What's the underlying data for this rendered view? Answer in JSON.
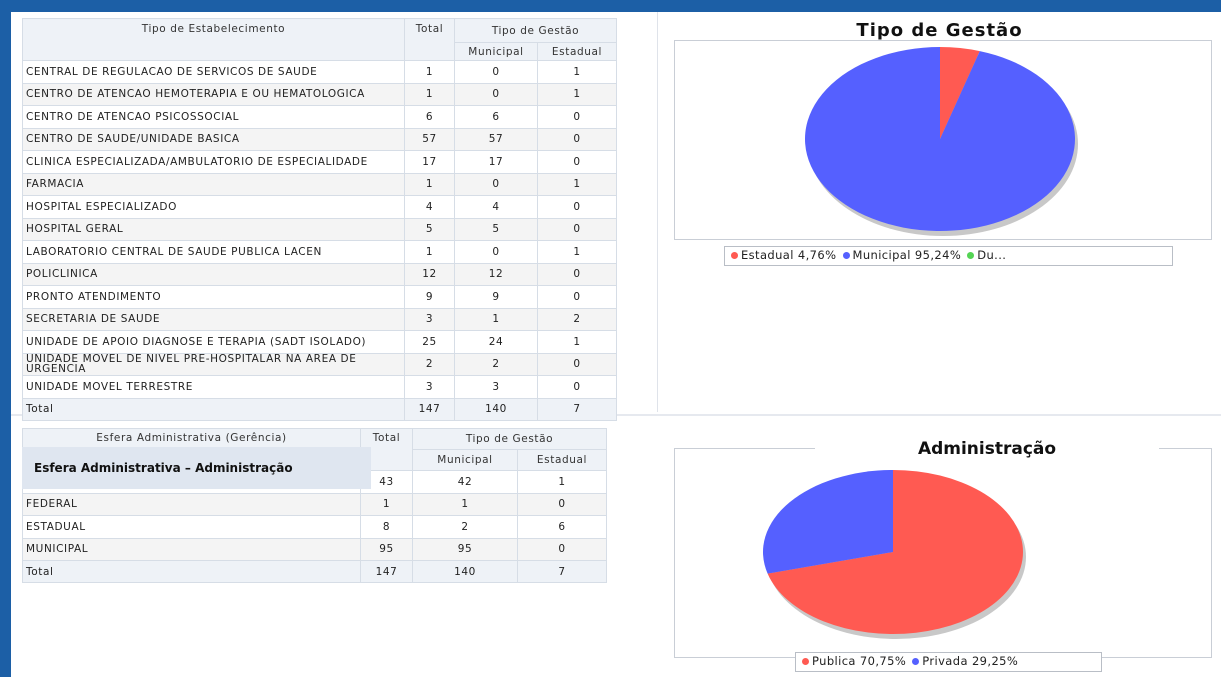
{
  "table_tipo": {
    "header_name": "Tipo de Estabelecimento",
    "header_total": "Total",
    "header_group": "Tipo de Gestão",
    "header_municipal": "Municipal",
    "header_estadual": "Estadual",
    "rows": [
      {
        "name": "CENTRAL DE REGULACAO DE SERVICOS DE SAUDE",
        "total": "1",
        "municipal": "0",
        "estadual": "1"
      },
      {
        "name": "CENTRO DE ATENCAO HEMOTERAPIA E OU HEMATOLOGICA",
        "total": "1",
        "municipal": "0",
        "estadual": "1"
      },
      {
        "name": "CENTRO DE ATENCAO PSICOSSOCIAL",
        "total": "6",
        "municipal": "6",
        "estadual": "0"
      },
      {
        "name": "CENTRO DE SAUDE/UNIDADE BASICA",
        "total": "57",
        "municipal": "57",
        "estadual": "0"
      },
      {
        "name": "CLINICA ESPECIALIZADA/AMBULATORIO DE ESPECIALIDADE",
        "total": "17",
        "municipal": "17",
        "estadual": "0"
      },
      {
        "name": "FARMACIA",
        "total": "1",
        "municipal": "0",
        "estadual": "1"
      },
      {
        "name": "HOSPITAL ESPECIALIZADO",
        "total": "4",
        "municipal": "4",
        "estadual": "0"
      },
      {
        "name": "HOSPITAL GERAL",
        "total": "5",
        "municipal": "5",
        "estadual": "0"
      },
      {
        "name": "LABORATORIO CENTRAL DE SAUDE PUBLICA LACEN",
        "total": "1",
        "municipal": "0",
        "estadual": "1"
      },
      {
        "name": "POLICLINICA",
        "total": "12",
        "municipal": "12",
        "estadual": "0"
      },
      {
        "name": "PRONTO ATENDIMENTO",
        "total": "9",
        "municipal": "9",
        "estadual": "0"
      },
      {
        "name": "SECRETARIA DE SAUDE",
        "total": "3",
        "municipal": "1",
        "estadual": "2"
      },
      {
        "name": "UNIDADE DE APOIO DIAGNOSE E TERAPIA (SADT ISOLADO)",
        "total": "25",
        "municipal": "24",
        "estadual": "1"
      },
      {
        "name": "UNIDADE MOVEL DE NIVEL PRE-HOSPITALAR NA AREA DE URGENCIA",
        "total": "2",
        "municipal": "2",
        "estadual": "0"
      },
      {
        "name": "UNIDADE MOVEL TERRESTRE",
        "total": "3",
        "municipal": "3",
        "estadual": "0"
      }
    ],
    "total_row": {
      "name": "Total",
      "total": "147",
      "municipal": "140",
      "estadual": "7"
    }
  },
  "table_esfera": {
    "header_name": "Esfera Administrativa (Gerência)",
    "header_total": "Total",
    "header_group": "Tipo de Gestão",
    "header_municipal": "Municipal",
    "header_estadual": "Estadual",
    "rows": [
      {
        "name": "",
        "total": "43",
        "municipal": "42",
        "estadual": "1"
      },
      {
        "name": "FEDERAL",
        "total": "1",
        "municipal": "1",
        "estadual": "0"
      },
      {
        "name": "ESTADUAL",
        "total": "8",
        "municipal": "2",
        "estadual": "6"
      },
      {
        "name": "MUNICIPAL",
        "total": "95",
        "municipal": "95",
        "estadual": "0"
      }
    ],
    "total_row": {
      "name": "Total",
      "total": "147",
      "municipal": "140",
      "estadual": "7"
    }
  },
  "overlay": {
    "label": "Esfera Administrativa – Administração",
    "title": "Administração"
  },
  "colors": {
    "red": "#ff5a52",
    "blue": "#5560ff",
    "green": "#54d454"
  },
  "chart_data": [
    {
      "type": "pie",
      "title": "Tipo de Gestão",
      "slices": [
        {
          "name": "Estadual",
          "value": 4.76,
          "label": "Estadual 4,76%",
          "color": "#ff5a52"
        },
        {
          "name": "Municipal",
          "value": 95.24,
          "label": "Municipal 95,24%",
          "color": "#5560ff"
        },
        {
          "name": "Dupla",
          "value": 0,
          "label": "Du...",
          "color": "#54d454"
        }
      ],
      "legend": "bottom"
    },
    {
      "type": "pie",
      "title": "Administração",
      "slices": [
        {
          "name": "Publica",
          "value": 70.75,
          "label": "Publica 70,75%",
          "color": "#ff5a52"
        },
        {
          "name": "Privada",
          "value": 29.25,
          "label": "Privada 29,25%",
          "color": "#5560ff"
        }
      ],
      "legend": "bottom"
    }
  ]
}
